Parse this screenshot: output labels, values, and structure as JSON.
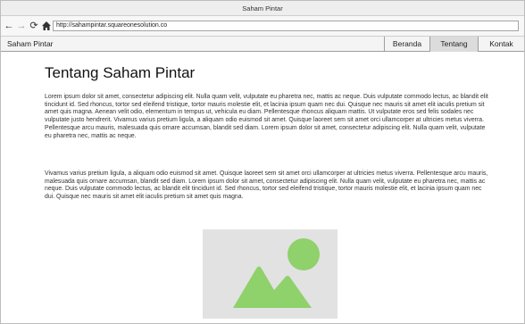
{
  "browser": {
    "title": "Saham Pintar",
    "url": "http://sahampintar.squareonesolution.co",
    "icons": [
      "back-arrow-icon",
      "forward-arrow-icon",
      "reload-icon",
      "home-icon"
    ]
  },
  "navbar": {
    "brand": "Saham Pintar",
    "items": [
      {
        "label": "Beranda",
        "active": false
      },
      {
        "label": "Tentang",
        "active": true
      },
      {
        "label": "Kontak",
        "active": false
      }
    ]
  },
  "main": {
    "title": "Tentang Saham Pintar",
    "paragraphs": [
      "Lorem ipsum dolor sit amet, consectetur adipiscing elit. Nulla quam velit, vulputate eu pharetra nec, mattis ac neque. Duis vulputate commodo lectus, ac blandit elit tincidunt id. Sed rhoncus, tortor sed eleifend tristique, tortor mauris molestie elit, et lacinia ipsum quam nec dui. Quisque nec mauris sit amet elit iaculis pretium sit amet quis magna. Aenean velit odio, elementum in tempus ut, vehicula eu diam. Pellentesque rhoncus aliquam mattis. Ut vulputate eros sed felis sodales nec vulputate justo hendrerit. Vivamus varius pretium ligula, a aliquam odio euismod sit amet. Quisque laoreet sem sit amet orci ullamcorper at ultricies metus viverra. Pellentesque arcu mauris, malesuada quis ornare accumsan, blandit sed diam. Lorem ipsum dolor sit amet, consectetur adipiscing elit. Nulla quam velit, vulputate eu pharetra nec, mattis ac neque.",
      "Vivamus varius pretium ligula, a aliquam odio euismod sit amet. Quisque laoreet sem sit amet orci ullamcorper at ultricies metus viverra. Pellentesque arcu mauris, malesuada quis ornare accumsan, blandit sed diam. Lorem ipsum dolor sit amet, consectetur adipiscing elit. Nulla quam velit, vulputate eu pharetra nec, mattis ac neque. Duis vulputate commodo lectus, ac blandit elit tincidunt id. Sed rhoncus, tortor sed eleifend tristique, tortor mauris molestie elit, et lacinia ipsum quam nec dui. Quisque nec mauris sit amet elit iaculis pretium sit amet quis magna."
    ],
    "image": {
      "icon": "image-placeholder-icon",
      "accent_color": "#8fd16a",
      "background_color": "#e2e2e2"
    }
  }
}
